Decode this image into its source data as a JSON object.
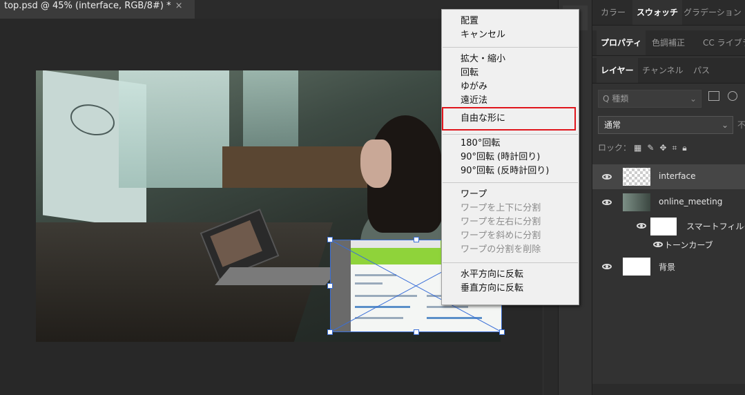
{
  "document": {
    "tab_title": "top.psd @ 45% (interface, RGB/8#) *",
    "close_glyph": "×"
  },
  "context_menu": {
    "items": [
      {
        "label": "配置",
        "enabled": true
      },
      {
        "label": "キャンセル",
        "enabled": true
      },
      {
        "label": "拡大・縮小",
        "enabled": true
      },
      {
        "label": "回転",
        "enabled": true
      },
      {
        "label": "ゆがみ",
        "enabled": true
      },
      {
        "label": "遠近法",
        "enabled": true
      },
      {
        "label": "自由な形に",
        "enabled": true,
        "highlighted": true
      },
      {
        "label": "180°回転",
        "enabled": true
      },
      {
        "label": "90°回転 (時計回り)",
        "enabled": true
      },
      {
        "label": "90°回転 (反時計回り)",
        "enabled": true
      },
      {
        "label": "ワープ",
        "enabled": true
      },
      {
        "label": "ワープを上下に分割",
        "enabled": false
      },
      {
        "label": "ワープを左右に分割",
        "enabled": false
      },
      {
        "label": "ワープを斜めに分割",
        "enabled": false
      },
      {
        "label": "ワープの分割を削除",
        "enabled": false
      },
      {
        "label": "水平方向に反転",
        "enabled": true
      },
      {
        "label": "垂直方向に反転",
        "enabled": true
      }
    ],
    "highlight_color": "#e0141b"
  },
  "panel": {
    "row1_tabs": [
      "カラー",
      "スウォッチ",
      "グラデーション"
    ],
    "row2_tabs": [
      "プロパティ",
      "色調補正",
      "CC ライブラ"
    ],
    "row3_tabs": [
      "レイヤー",
      "チャンネル",
      "パス"
    ],
    "search_placeholder": "Q 種類",
    "blend_mode": "通常",
    "blend_extra": "不",
    "lock_label": "ロック：",
    "layers": [
      {
        "name": "interface",
        "selected": true
      },
      {
        "name": "online_meeting",
        "selected": false
      },
      {
        "name": "スマートフィルタ",
        "selected": false
      },
      {
        "name": "トーンカーブ",
        "selected": false
      },
      {
        "name": "背景",
        "selected": false
      }
    ]
  }
}
